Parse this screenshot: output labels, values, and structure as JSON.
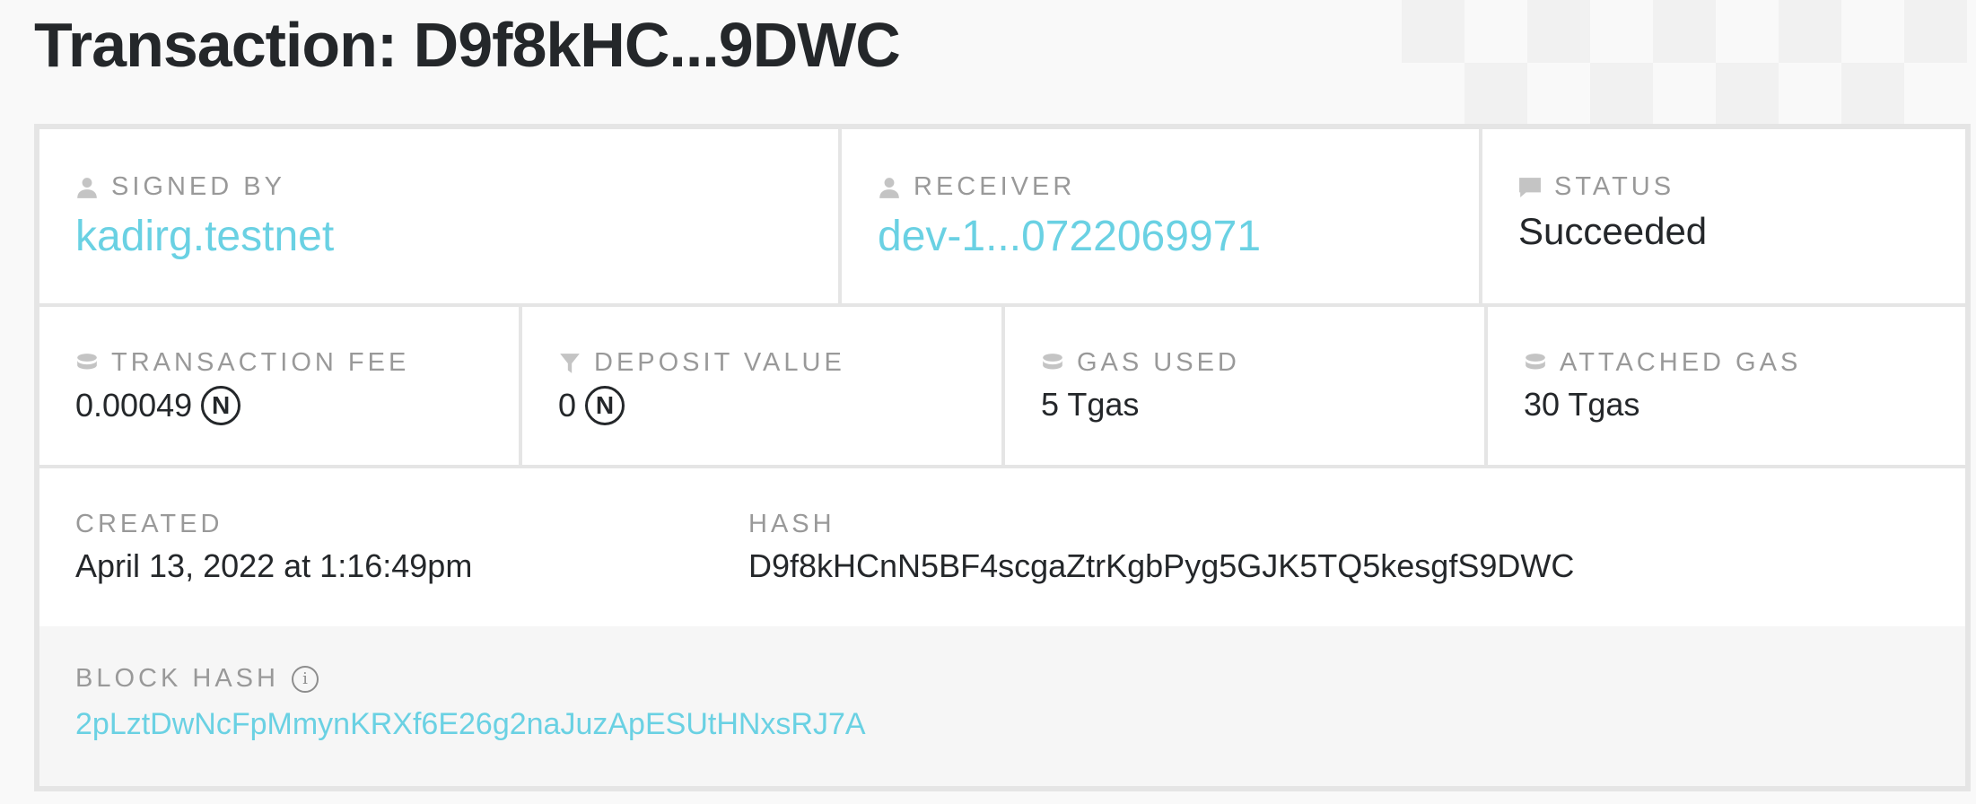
{
  "page": {
    "title": "Transaction: D9f8kHC...9DWC"
  },
  "signed_by": {
    "label": "SIGNED BY",
    "value": "kadirg.testnet",
    "icon": "user-icon"
  },
  "receiver": {
    "label": "RECEIVER",
    "value": "dev-1...0722069971",
    "icon": "user-icon"
  },
  "status": {
    "label": "STATUS",
    "value": "Succeeded",
    "icon": "comment-icon"
  },
  "transaction_fee": {
    "label": "TRANSACTION FEE",
    "value": "0.00049",
    "token": "N",
    "icon": "coins-icon"
  },
  "deposit_value": {
    "label": "DEPOSIT VALUE",
    "value": "0",
    "token": "N",
    "icon": "filter-icon"
  },
  "gas_used": {
    "label": "GAS USED",
    "value": "5 Tgas",
    "icon": "coins-icon"
  },
  "attached_gas": {
    "label": "ATTACHED GAS",
    "value": "30 Tgas",
    "icon": "coins-icon"
  },
  "created": {
    "label": "CREATED",
    "value": "April 13, 2022 at 1:16:49pm"
  },
  "hash": {
    "label": "HASH",
    "value": "D9f8kHCnN5BF4scgaZtrKgbPyg5GJK5TQ5kesgfS9DWC"
  },
  "block_hash": {
    "label": "BLOCK HASH",
    "value": "2pLztDwNcFpMmynKRXf6E26g2naJuzApESUtHNxsRJ7A",
    "info_icon": "i"
  },
  "colors": {
    "link": "#6ad1e3",
    "label": "#999999",
    "text": "#24272a",
    "border": "#e5e5e5"
  }
}
